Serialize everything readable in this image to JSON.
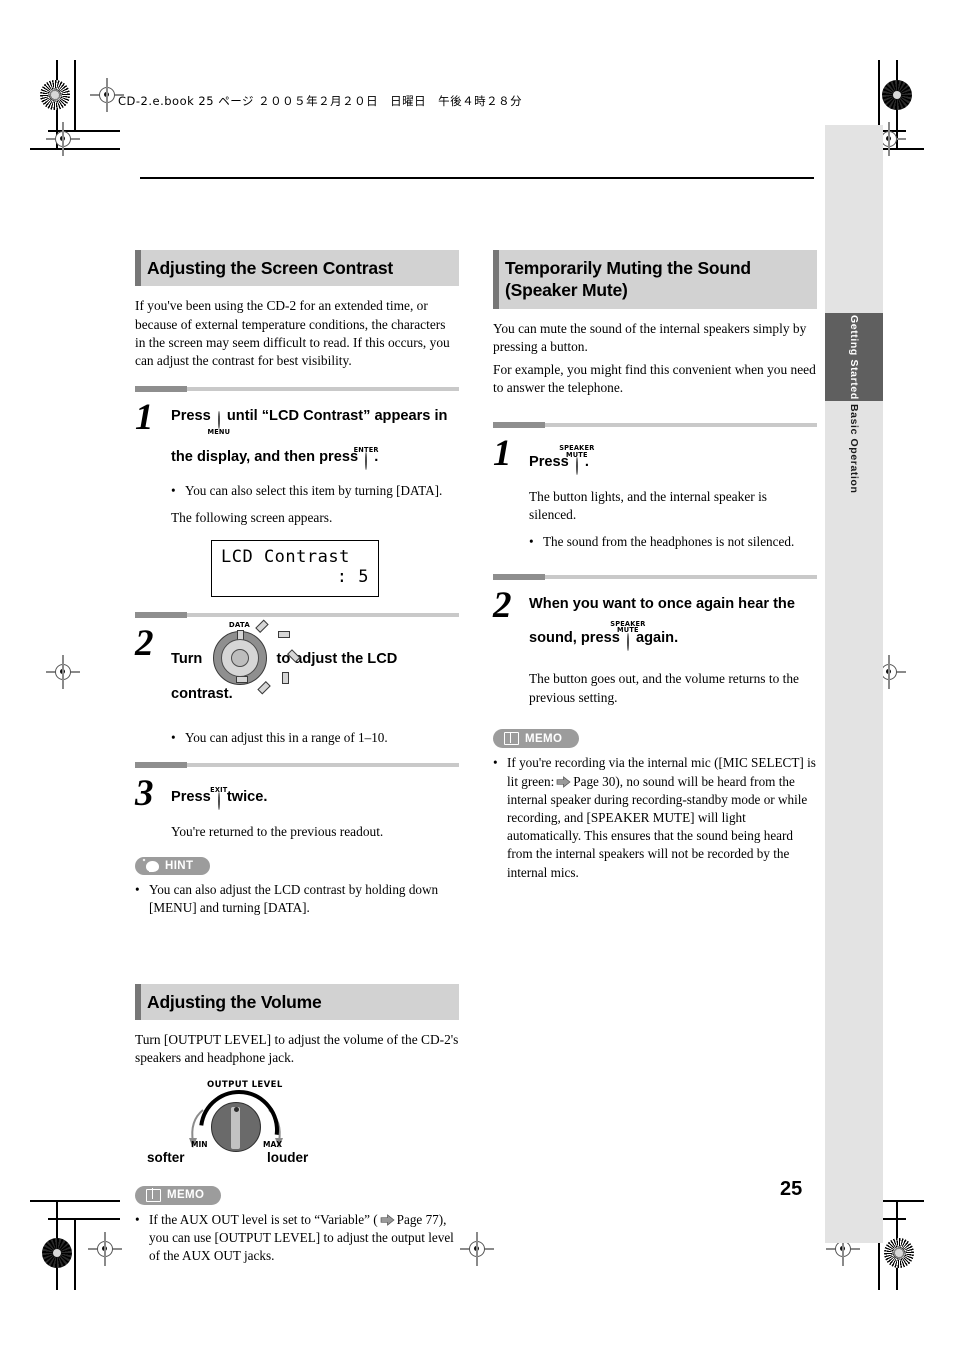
{
  "page": {
    "file_header": "CD-2.e.book  25 ページ  ２００５年２月２０日　日曜日　午後４時２８分",
    "page_number": "25"
  },
  "side_tabs": [
    {
      "label": "Getting Started",
      "active": true
    },
    {
      "label": "Basic Operation",
      "active": false
    }
  ],
  "left_column": {
    "section1": {
      "heading": "Adjusting the Screen Contrast",
      "intro": "If you've been using the CD-2 for an extended time, or because of external temperature conditions, the characters in the screen may seem difficult to read. If this occurs, you can adjust the contrast for best visibility.",
      "steps": [
        {
          "number": "1",
          "title_part1": "Press",
          "button1_label": "MENU",
          "title_part2": "until “LCD Contrast” appears in the display, and then press",
          "button2_label": "ENTER",
          "title_part3": ".",
          "bullet": "You can also select this item by turning [DATA].",
          "note": "The following screen appears."
        },
        {
          "number": "2",
          "title_part1": "Turn",
          "knob_label": "DATA",
          "title_part2": "to adjust the LCD contrast.",
          "bullet": "You can adjust this in a range of 1–10."
        },
        {
          "number": "3",
          "title_part1": "Press",
          "button1_label": "EXIT",
          "title_part2": "twice.",
          "note": "You're returned to the previous readout."
        }
      ],
      "lcd": {
        "line1": "LCD Contrast",
        "line2": ": 5"
      },
      "hint": {
        "badge": "HINT",
        "icon": "lightbulb-icon",
        "bullet": "You can also adjust the LCD contrast by holding down [MENU] and turning [DATA]."
      }
    },
    "section2": {
      "heading": "Adjusting the Volume",
      "intro": "Turn [OUTPUT LEVEL] to adjust the volume of the CD-2's speakers and headphone jack.",
      "figure": {
        "title": "OUTPUT LEVEL",
        "min_label": "MIN",
        "max_label": "MAX",
        "left_label": "softer",
        "right_label": "louder"
      },
      "memo": {
        "badge": "MEMO",
        "icon": "book-icon",
        "bullet_part1": "If the AUX OUT level is set to “Variable” (",
        "arrow_icon": "arrow-right-icon",
        "bullet_part2": "Page 77), you can use [OUTPUT LEVEL] to adjust the output level of the AUX OUT jacks."
      }
    }
  },
  "right_column": {
    "section1": {
      "heading_line1": "Temporarily Muting the Sound",
      "heading_line2": "(Speaker Mute)",
      "intro_p1": "You can mute the sound of the internal speakers simply by pressing a button.",
      "intro_p2": "For example, you might find this convenient when you need to answer the telephone.",
      "steps": [
        {
          "number": "1",
          "title_part1": "Press",
          "button_label_line1": "SPEAKER",
          "button_label_line2": "MUTE",
          "title_part2": ".",
          "note": "The button lights, and the internal speaker is silenced.",
          "bullet": "The sound from the headphones is not silenced."
        },
        {
          "number": "2",
          "title_part1": "When you want to once again hear the sound, press",
          "button_label_line1": "SPEAKER",
          "button_label_line2": "MUTE",
          "title_part2": "again.",
          "note": "The button goes out, and the volume returns to the previous setting."
        }
      ],
      "memo": {
        "badge": "MEMO",
        "icon": "book-icon",
        "bullet_part1": "If you're recording via the internal mic ([MIC SELECT] is lit green:",
        "arrow_icon": "arrow-right-icon",
        "bullet_part2": "Page 30), no sound will be heard from the internal speaker during recording-standby mode or while recording, and [SPEAKER MUTE] will light automatically. This ensures that the sound being heard from the internal speakers will not be recorded by the internal mics."
      }
    }
  }
}
